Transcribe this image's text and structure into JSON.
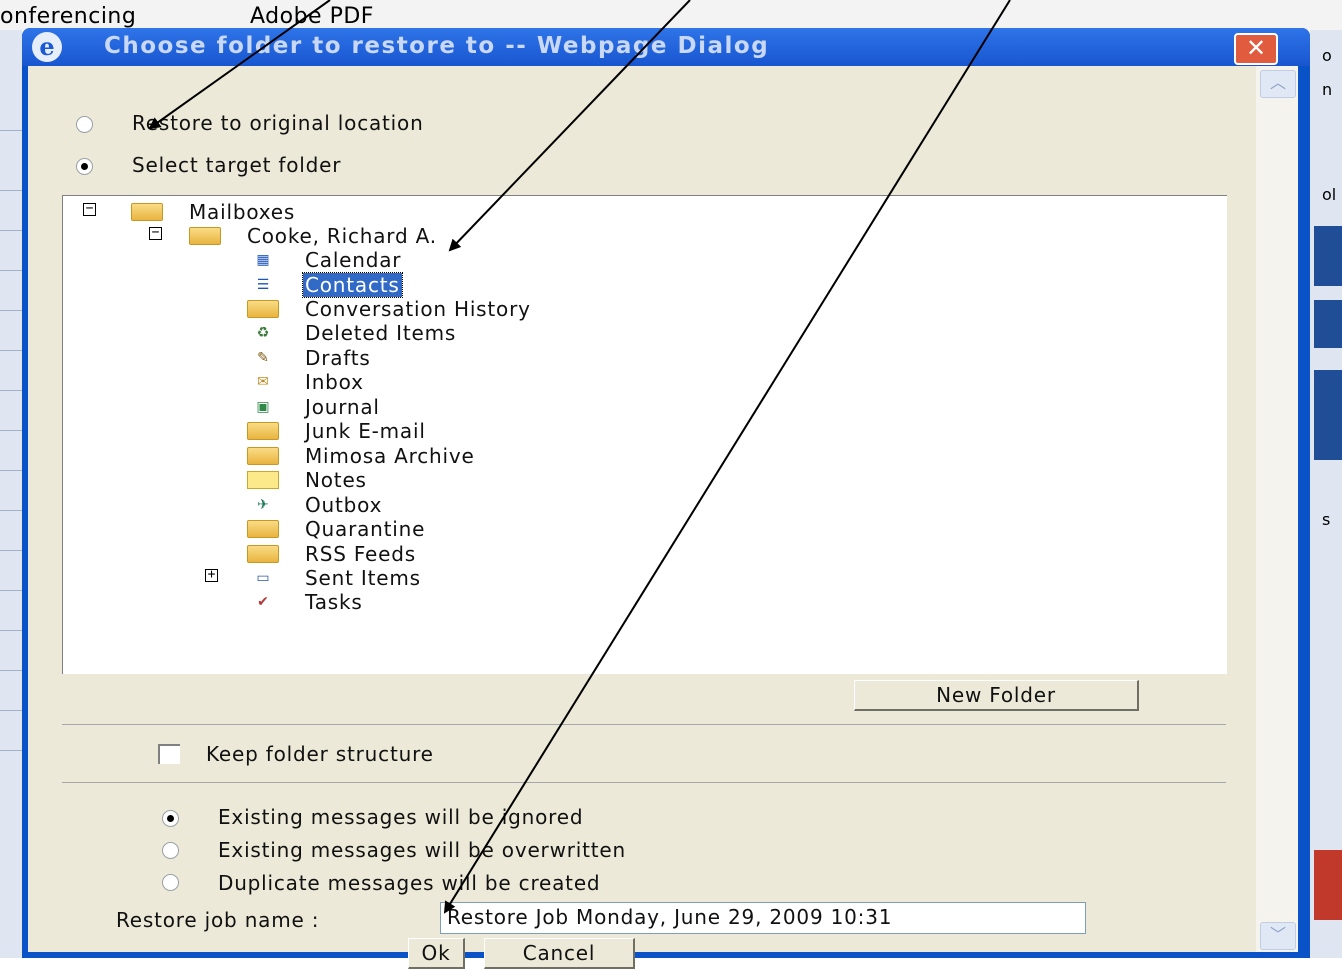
{
  "background_menu": [
    "onferencing",
    "Adobe PDF"
  ],
  "background_right_chars": [
    "o",
    "n",
    "ol",
    "s"
  ],
  "dialog": {
    "title": "Choose folder to restore to -- Webpage Dialog",
    "close_glyph": "✕",
    "browser_icon": "e"
  },
  "restore_options": {
    "original": "Restore to original location",
    "target": "Select target folder",
    "selected": "target"
  },
  "tree": {
    "root": "Mailboxes",
    "mailbox": "Cooke, Richard A.",
    "folders": [
      {
        "label": "Calendar",
        "icon": "calendar-icon",
        "glyph": "▦"
      },
      {
        "label": "Contacts",
        "icon": "contacts-icon",
        "glyph": "☰",
        "selected": true
      },
      {
        "label": "Conversation History",
        "icon": "folder-icon"
      },
      {
        "label": "Deleted Items",
        "icon": "trash-icon",
        "glyph": "♻"
      },
      {
        "label": "Drafts",
        "icon": "drafts-icon",
        "glyph": "✎"
      },
      {
        "label": "Inbox",
        "icon": "inbox-icon",
        "glyph": "✉"
      },
      {
        "label": "Journal",
        "icon": "journal-icon",
        "glyph": "▣"
      },
      {
        "label": "Junk E-mail",
        "icon": "folder-icon"
      },
      {
        "label": "Mimosa Archive",
        "icon": "folder-icon"
      },
      {
        "label": "Notes",
        "icon": "notes-icon"
      },
      {
        "label": "Outbox",
        "icon": "outbox-icon",
        "glyph": "✈"
      },
      {
        "label": "Quarantine",
        "icon": "folder-icon"
      },
      {
        "label": "RSS Feeds",
        "icon": "folder-icon"
      },
      {
        "label": "Sent Items",
        "icon": "sent-items-icon",
        "glyph": "▭",
        "expandable": true
      },
      {
        "label": "Tasks",
        "icon": "tasks-icon",
        "glyph": "✔"
      }
    ]
  },
  "new_folder_label": "New Folder",
  "keep_structure_label": "Keep folder structure",
  "keep_structure_checked": false,
  "existing": {
    "ignored": "Existing messages will be ignored",
    "overwritten": "Existing messages will be overwritten",
    "duplicate": "Duplicate messages will be created",
    "selected": "ignored"
  },
  "job_name_label": "Restore job name :",
  "job_name_value": "Restore Job Monday, June 29, 2009 10:31",
  "ok_label": "Ok",
  "cancel_label": "Cancel",
  "colors": {
    "titlebar": "#1856d0",
    "client": "#ece9d8",
    "selection": "#3169c6",
    "close": "#e15b3f"
  }
}
